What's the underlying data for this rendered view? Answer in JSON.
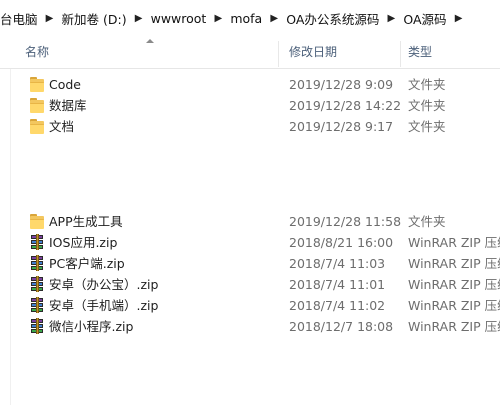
{
  "breadcrumb": [
    {
      "label": "台电脑"
    },
    {
      "label": "新加卷 (D:)"
    },
    {
      "label": "wwwroot"
    },
    {
      "label": "mofa"
    },
    {
      "label": "OA办公系统源码"
    },
    {
      "label": "OA源码"
    }
  ],
  "columns": {
    "name": "名称",
    "date": "修改日期",
    "type": "类型"
  },
  "files": [
    {
      "name": "Code",
      "date": "2019/12/28 9:09",
      "type": "文件夹",
      "icon": "folder-icon"
    },
    {
      "name": "数据库",
      "date": "2019/12/28 14:22",
      "type": "文件夹",
      "icon": "folder-icon"
    },
    {
      "name": "文档",
      "date": "2019/12/28 9:17",
      "type": "文件夹",
      "icon": "folder-icon"
    },
    {
      "name": "APP生成工具",
      "date": "2019/12/28 11:58",
      "type": "文件夹",
      "icon": "folder-icon"
    },
    {
      "name": "IOS应用.zip",
      "date": "2018/8/21 16:00",
      "type": "WinRAR ZIP 压缩",
      "icon": "winrar-zip-icon"
    },
    {
      "name": "PC客户端.zip",
      "date": "2018/7/4 11:03",
      "type": "WinRAR ZIP 压缩",
      "icon": "winrar-zip-icon"
    },
    {
      "name": "安卓（办公宝）.zip",
      "date": "2018/7/4 11:01",
      "type": "WinRAR ZIP 压缩",
      "icon": "winrar-zip-icon"
    },
    {
      "name": "安卓（手机端）.zip",
      "date": "2018/7/4 11:02",
      "type": "WinRAR ZIP 压缩",
      "icon": "winrar-zip-icon"
    },
    {
      "name": "微信小程序.zip",
      "date": "2018/12/7 18:08",
      "type": "WinRAR ZIP 压缩",
      "icon": "winrar-zip-icon"
    }
  ]
}
